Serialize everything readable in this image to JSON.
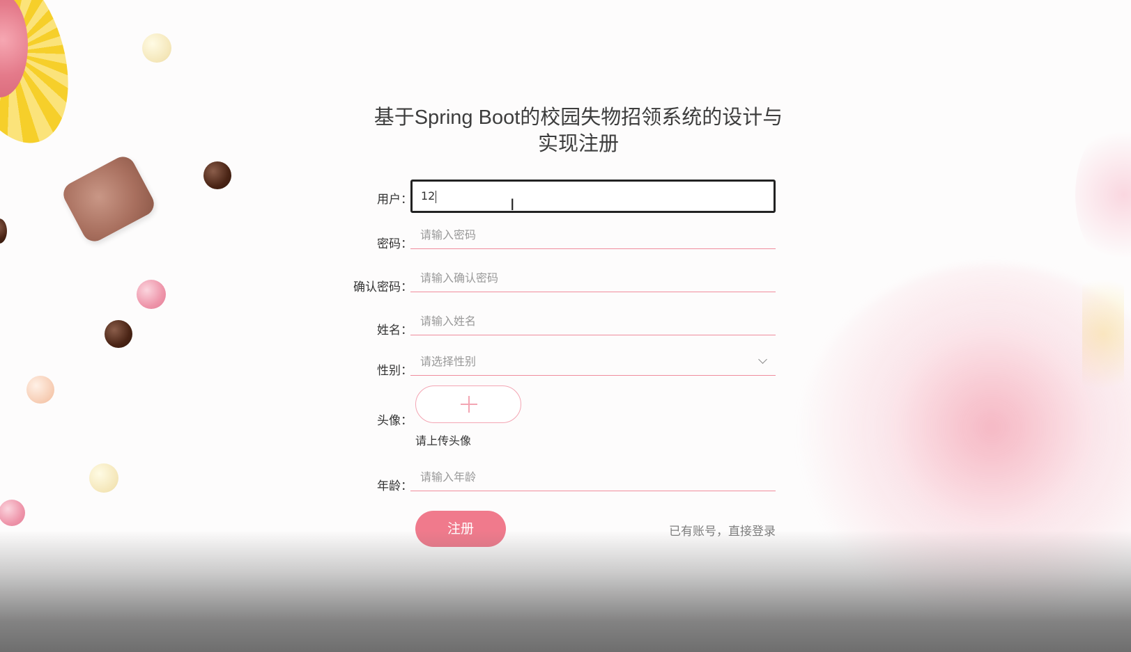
{
  "page": {
    "title": "基于Spring Boot的校园失物招领系统的设计与实现注册"
  },
  "form": {
    "username": {
      "label": "用户：",
      "value": "12"
    },
    "password": {
      "label": "密码：",
      "placeholder": "请输入密码"
    },
    "confirm_password": {
      "label": "确认密码：",
      "placeholder": "请输入确认密码"
    },
    "name": {
      "label": "姓名：",
      "placeholder": "请输入姓名"
    },
    "gender": {
      "label": "性别：",
      "placeholder": "请选择性别"
    },
    "avatar": {
      "label": "头像：",
      "hint": "请上传头像"
    },
    "age": {
      "label": "年龄：",
      "placeholder": "请输入年龄"
    }
  },
  "actions": {
    "register_label": "注册",
    "login_link": "已有账号，直接登录"
  },
  "icons": {
    "upload": "plus-icon",
    "select": "chevron-down-icon",
    "cursor": "text-cursor-icon"
  },
  "colors": {
    "accent": "#f07a8c",
    "underline": "#f08c9c",
    "placeholder": "#999999"
  }
}
